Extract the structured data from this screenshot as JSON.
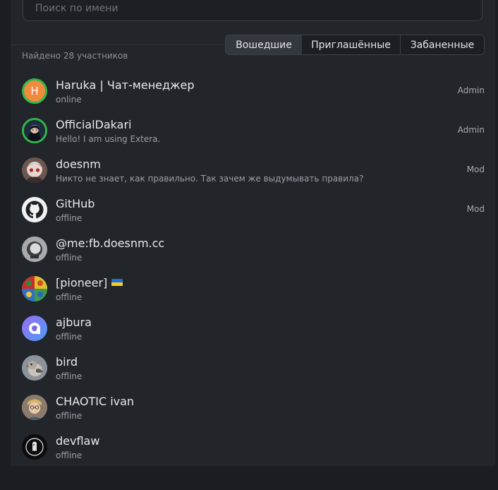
{
  "search": {
    "placeholder": "Поиск по имени",
    "value": ""
  },
  "summary": {
    "found_text": "Найдено 28 участников"
  },
  "tabs": [
    {
      "label": "Вошедшие",
      "active": true
    },
    {
      "label": "Приглашённые",
      "active": false
    },
    {
      "label": "Забаненные",
      "active": false
    }
  ],
  "colors": {
    "online_ring": "#2fb84a",
    "accent_avatar": "#f08a3e"
  },
  "members": [
    {
      "name": "Haruka | Чат-менеджер",
      "status": "online",
      "role": "Admin",
      "avatar_letter": "H",
      "online": true
    },
    {
      "name": "OfficialDakari",
      "status": "Hello! I am using Extera.",
      "role": "Admin",
      "online": true
    },
    {
      "name": "doesnm",
      "status": "Никто не знает, как правильно. Так зачем же выдумывать правила?",
      "role": "Mod"
    },
    {
      "name": "GitHub",
      "status": "offline",
      "role": "Mod",
      "avatar_icon": "github-icon"
    },
    {
      "name": "@me:fb.doesnm.cc",
      "status": "offline",
      "role": ""
    },
    {
      "name": "[pioneer]",
      "status": "offline",
      "role": "",
      "flag_icon": "ukraine-flag-icon"
    },
    {
      "name": "ajbura",
      "status": "offline",
      "role": ""
    },
    {
      "name": "bird",
      "status": "offline",
      "role": ""
    },
    {
      "name": "CHAOTIC ivan",
      "status": "offline",
      "role": ""
    },
    {
      "name": "devflaw",
      "status": "offline",
      "role": ""
    }
  ]
}
